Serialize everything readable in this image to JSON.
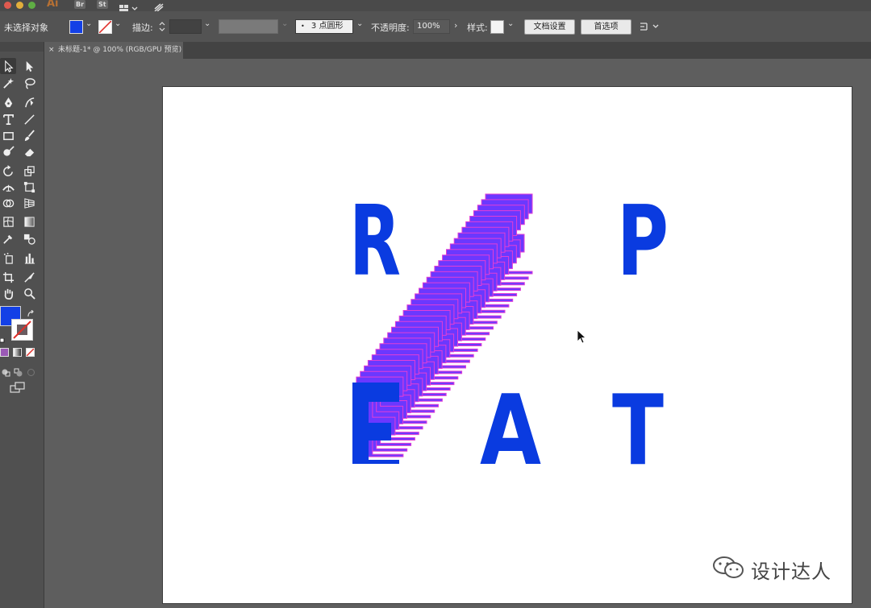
{
  "window": {
    "app_logo": "Ai",
    "bridge_label": "Br",
    "stock_label": "St"
  },
  "control_bar": {
    "selection_status": "未选择对象",
    "stroke_label": "描边:",
    "brush_value": "3 点圆形",
    "opacity_label": "不透明度:",
    "opacity_value": "100%",
    "style_label": "样式:",
    "document_setup_button": "文档设置",
    "preferences_button": "首选项",
    "fill_color": "#1340e6"
  },
  "document_tab": {
    "close": "×",
    "title": "未标题-1* @ 100% (RGB/GPU 预览)"
  },
  "artwork": {
    "letters": [
      "R",
      "E",
      "P",
      "E",
      "A",
      "T"
    ],
    "fill_color": "#0a3be0",
    "echo_color": "#6b38ff",
    "echo_outline_color": "#e23ed5"
  },
  "watermark": {
    "text": "设计达人"
  }
}
